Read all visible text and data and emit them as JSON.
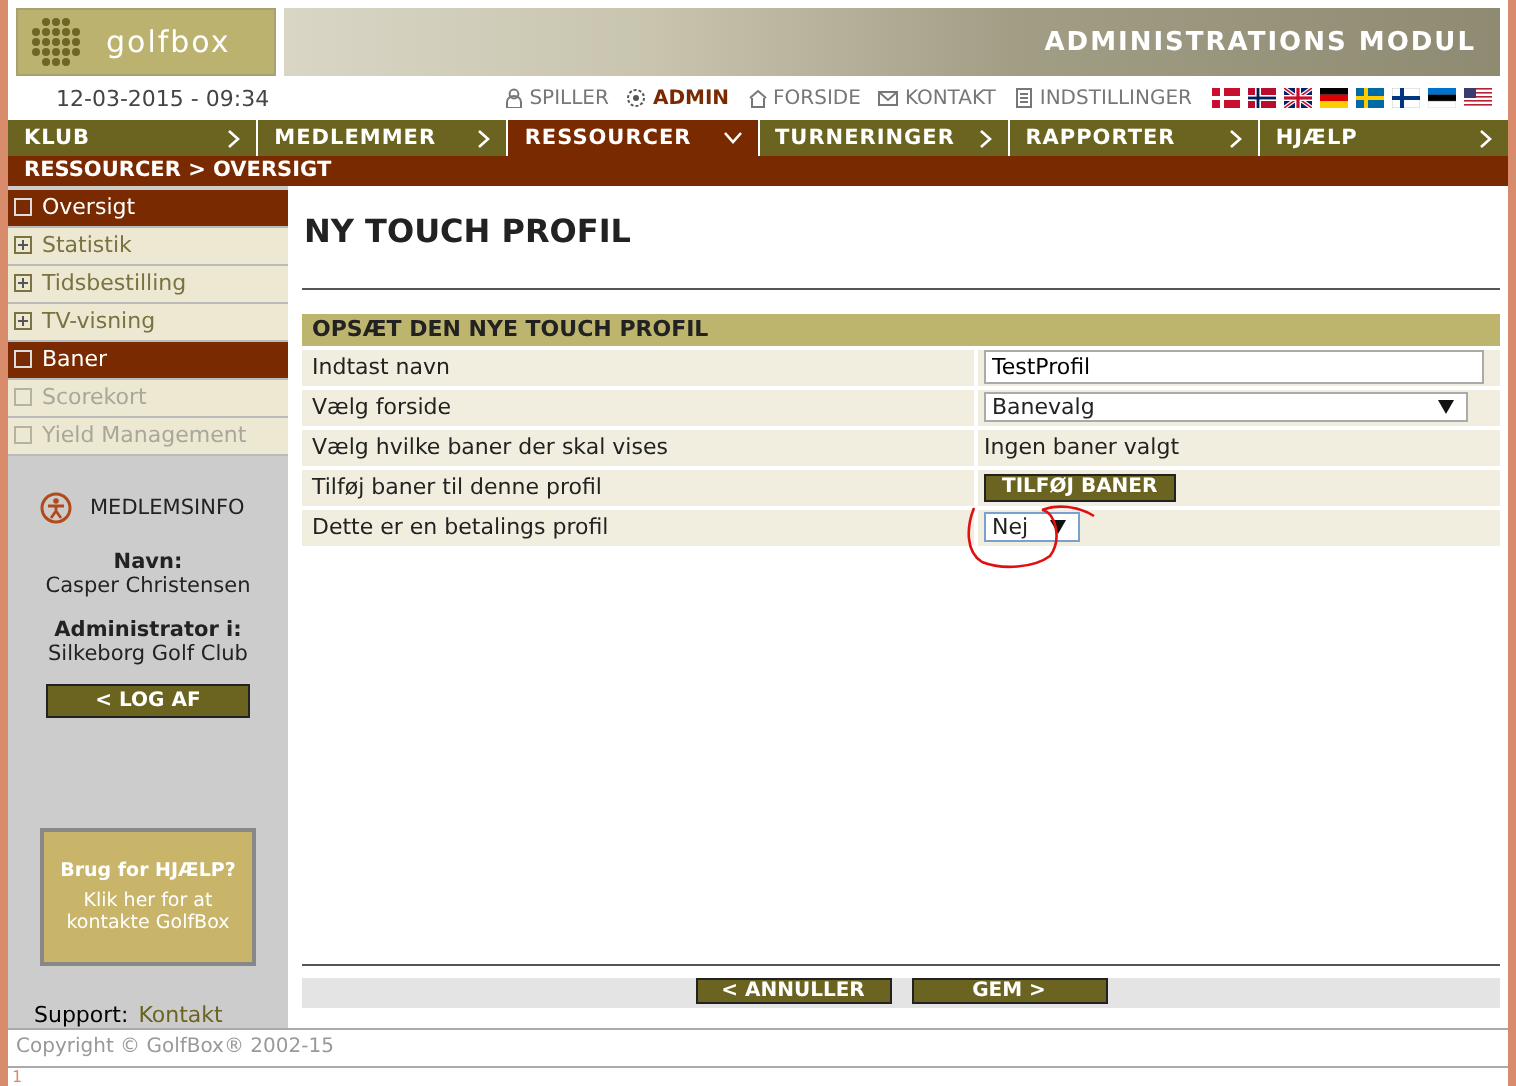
{
  "header": {
    "logo": "golfbox",
    "title": "ADMINISTRATIONS MODUL"
  },
  "topbar": {
    "datetime": "12-03-2015 - 09:34",
    "links": [
      {
        "label": "SPILLER",
        "selected": false
      },
      {
        "label": "ADMIN",
        "selected": true
      },
      {
        "label": "FORSIDE",
        "selected": false
      },
      {
        "label": "KONTAKT",
        "selected": false
      },
      {
        "label": "INDSTILLINGER",
        "selected": false
      }
    ]
  },
  "nav": [
    {
      "label": "KLUB",
      "selected": false
    },
    {
      "label": "MEDLEMMER",
      "selected": false
    },
    {
      "label": "RESSOURCER",
      "selected": true
    },
    {
      "label": "TURNERINGER",
      "selected": false
    },
    {
      "label": "RAPPORTER",
      "selected": false
    },
    {
      "label": "HJÆLP",
      "selected": false
    }
  ],
  "breadcrumb": "RESSOURCER > OVERSIGT",
  "sidebar": {
    "items": [
      {
        "label": "Oversigt",
        "kind": "page",
        "selected": true,
        "disabled": false
      },
      {
        "label": "Statistik",
        "kind": "group",
        "selected": false,
        "disabled": false
      },
      {
        "label": "Tidsbestilling",
        "kind": "group",
        "selected": false,
        "disabled": false
      },
      {
        "label": "TV-visning",
        "kind": "group",
        "selected": false,
        "disabled": false
      },
      {
        "label": "Baner",
        "kind": "page",
        "selected": true,
        "disabled": false
      },
      {
        "label": "Scorekort",
        "kind": "page",
        "selected": false,
        "disabled": true
      },
      {
        "label": "Yield Management",
        "kind": "page",
        "selected": false,
        "disabled": true
      }
    ],
    "member": {
      "heading": "MEDLEMSINFO",
      "name_label": "Navn:",
      "name": "Casper Christensen",
      "admin_label": "Administrator i:",
      "club": "Silkeborg Golf Club",
      "logout": "< LOG AF"
    },
    "help": {
      "title": "Brug for HJÆLP?",
      "text": "Klik her for at kontakte GolfBox"
    },
    "support": {
      "label": "Support:",
      "link": "Kontakt"
    }
  },
  "main": {
    "title": "NY TOUCH PROFIL",
    "form": {
      "heading": "OPSÆT DEN NYE TOUCH PROFIL",
      "rows": [
        {
          "label": "Indtast navn",
          "kind": "text",
          "value": "TestProfil",
          "highlighted": false
        },
        {
          "label": "Vælg forside",
          "kind": "select",
          "value": "Banevalg",
          "highlighted": false
        },
        {
          "label": "Vælg hvilke baner der skal vises",
          "kind": "static",
          "value": "Ingen baner valgt",
          "highlighted": false
        },
        {
          "label": "Tilføj baner til denne profil",
          "kind": "button",
          "value": "TILFØJ BANER",
          "highlighted": false
        },
        {
          "label": "Dette er en betalings profil",
          "kind": "small-select",
          "value": "Nej",
          "highlighted": true
        }
      ]
    },
    "buttons": [
      "< ANNULLER",
      "GEM >"
    ]
  },
  "footer": {
    "copyright": "Copyright © GolfBox® 2002-15",
    "page_number": "1"
  }
}
